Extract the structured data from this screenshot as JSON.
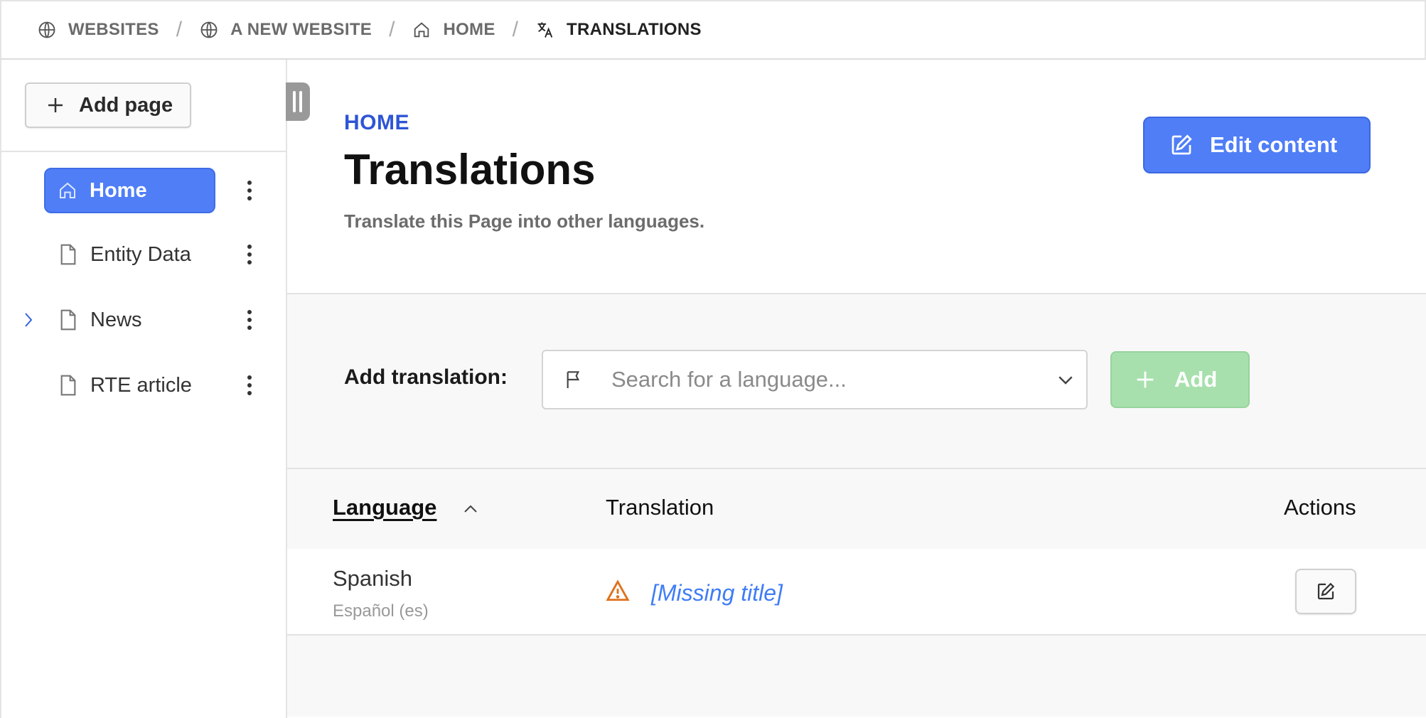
{
  "breadcrumb": [
    {
      "label": "WEBSITES",
      "icon": "globe-icon"
    },
    {
      "label": "A NEW WEBSITE",
      "icon": "globe-icon"
    },
    {
      "label": "HOME",
      "icon": "home-icon"
    },
    {
      "label": "TRANSLATIONS",
      "icon": "translate-icon"
    }
  ],
  "sidebar": {
    "add_page_label": "Add page",
    "items": [
      {
        "label": "Home",
        "icon": "home-icon",
        "active": true
      },
      {
        "label": "Entity Data",
        "icon": "page-icon"
      },
      {
        "label": "News",
        "icon": "page-icon",
        "expandable": true
      },
      {
        "label": "RTE article",
        "icon": "page-icon"
      }
    ]
  },
  "header": {
    "eyebrow": "HOME",
    "title": "Translations",
    "description": "Translate this Page into other languages.",
    "edit_button_label": "Edit content"
  },
  "add_translation": {
    "label": "Add translation:",
    "search_placeholder": "Search for a language...",
    "add_button_label": "Add"
  },
  "table": {
    "columns": {
      "language": "Language",
      "translation": "Translation",
      "actions": "Actions"
    },
    "rows": [
      {
        "language": "Spanish",
        "native": "Español (es)",
        "translation": "[Missing title]"
      }
    ]
  },
  "colors": {
    "primary": "#4f7ef7",
    "eyebrow": "#2e55d6",
    "add_disabled": "#a7e0ac",
    "warning": "#e0701a",
    "link": "#3f7cf6"
  }
}
